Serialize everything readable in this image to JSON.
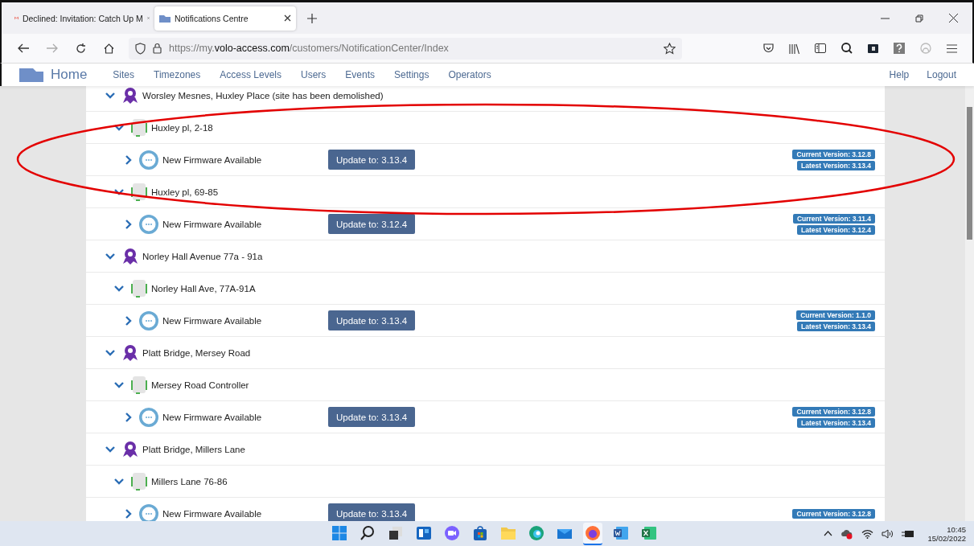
{
  "browser": {
    "tabs": [
      {
        "title": "Declined: Invitation: Catch Up M",
        "selected": false
      },
      {
        "title": "Notifications Centre",
        "selected": true
      }
    ],
    "url": {
      "host_prefix": "https://my.",
      "host": "volo-access.com",
      "path": "/customers/NotificationCenter/Index"
    }
  },
  "nav": {
    "brand": "Home",
    "links": [
      "Sites",
      "Timezones",
      "Access Levels",
      "Users",
      "Events",
      "Settings",
      "Operators"
    ],
    "right_links": [
      "Help",
      "Logout"
    ]
  },
  "sites": [
    {
      "name": "Worsley Mesnes, Huxley Place (site has been demolished)",
      "expanded": true,
      "controllers": [
        {
          "name": "Huxley pl, 2-18",
          "expanded": true,
          "notifications": [
            {
              "title": "New Firmware Available",
              "expanded": false,
              "button": "Update to: 3.13.4",
              "current": "Current Version: 3.12.8",
              "latest": "Latest Version: 3.13.4"
            }
          ]
        },
        {
          "name": "Huxley pl, 69-85",
          "expanded": true,
          "notifications": [
            {
              "title": "New Firmware Available",
              "expanded": false,
              "button": "Update to: 3.12.4",
              "current": "Current Version: 3.11.4",
              "latest": "Latest Version: 3.12.4"
            }
          ]
        }
      ]
    },
    {
      "name": "Norley Hall Avenue 77a - 91a",
      "expanded": true,
      "controllers": [
        {
          "name": "Norley Hall Ave, 77A-91A",
          "expanded": true,
          "notifications": [
            {
              "title": "New Firmware Available",
              "expanded": false,
              "button": "Update to: 3.13.4",
              "current": "Current Version: 1.1.0",
              "latest": "Latest Version: 3.13.4"
            }
          ]
        }
      ]
    },
    {
      "name": "Platt Bridge, Mersey Road",
      "expanded": true,
      "controllers": [
        {
          "name": "Mersey Road Controller",
          "expanded": true,
          "notifications": [
            {
              "title": "New Firmware Available",
              "expanded": false,
              "button": "Update to: 3.13.4",
              "current": "Current Version: 3.12.8",
              "latest": "Latest Version: 3.13.4"
            }
          ]
        }
      ]
    },
    {
      "name": "Platt Bridge, Millers Lane",
      "expanded": true,
      "controllers": [
        {
          "name": "Millers Lane 76-86",
          "expanded": true,
          "notifications": [
            {
              "title": "New Firmware Available",
              "expanded": false,
              "button": "Update to: 3.13.4",
              "current": "Current Version: 3.12.8"
            }
          ]
        }
      ]
    }
  ],
  "taskbar": {
    "apps": [
      {
        "kind": "start",
        "selected": false
      },
      {
        "kind": "search",
        "selected": false
      },
      {
        "kind": "taskview",
        "selected": false
      },
      {
        "kind": "widgets",
        "selected": false
      },
      {
        "kind": "chat",
        "selected": false
      },
      {
        "kind": "store",
        "selected": false
      },
      {
        "kind": "files",
        "selected": false
      },
      {
        "kind": "edge",
        "selected": false
      },
      {
        "kind": "mail",
        "selected": false
      },
      {
        "kind": "firefox",
        "selected": true
      },
      {
        "kind": "word",
        "selected": false
      },
      {
        "kind": "excel",
        "selected": false
      }
    ],
    "time": "10:45",
    "date": "15/02/2022"
  }
}
